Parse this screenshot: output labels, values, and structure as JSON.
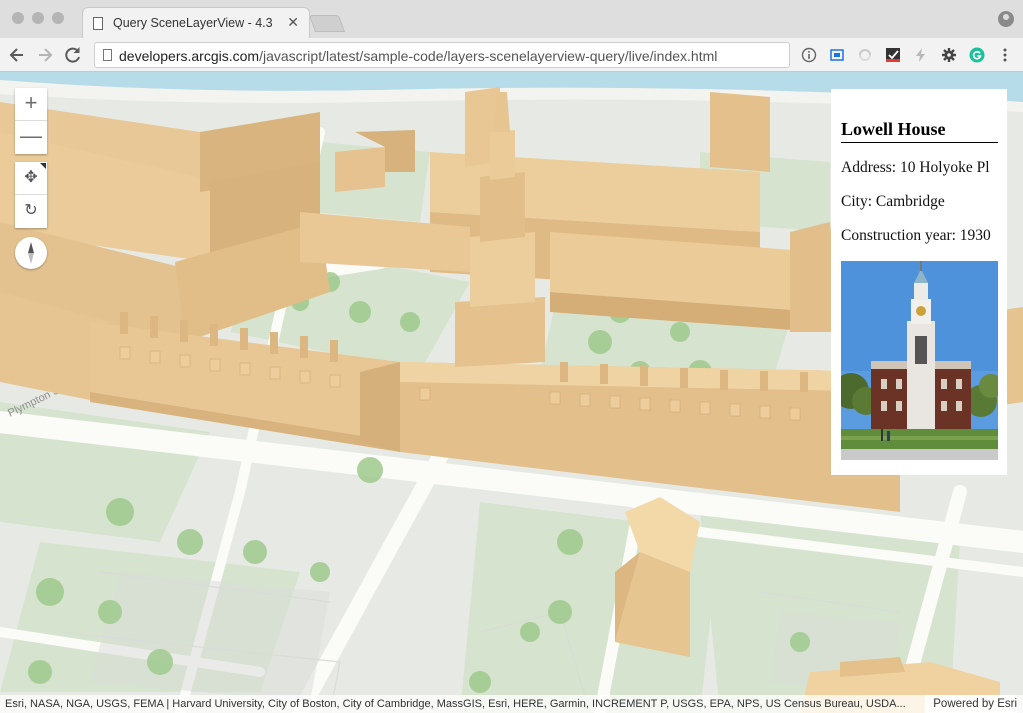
{
  "browser": {
    "tab_title": "Query SceneLayerView - 4.3",
    "tab_close": "✕",
    "url_host": "developers.arcgis.com",
    "url_path": "/javascript/latest/sample-code/layers-scenelayerview-query/live/index.html"
  },
  "map": {
    "zoom_in": "+",
    "zoom_out": "—",
    "pan_icon": "✥",
    "rotate_icon": "↻",
    "street_label": "Plympton St",
    "popup": {
      "title": "Lowell House",
      "address": "Address: 10 Holyoke Pl",
      "city": "City: Cambridge",
      "year": "Construction year: 1930"
    },
    "attribution": "Esri, NASA, NGA, USGS, FEMA | Harvard University, City of Boston, City of Cambridge, MassGIS, Esri, HERE, Garmin, INCREMENT P, USGS, EPA, NPS, US Census Bureau, USDA...",
    "powered_by": "Powered by Esri"
  }
}
